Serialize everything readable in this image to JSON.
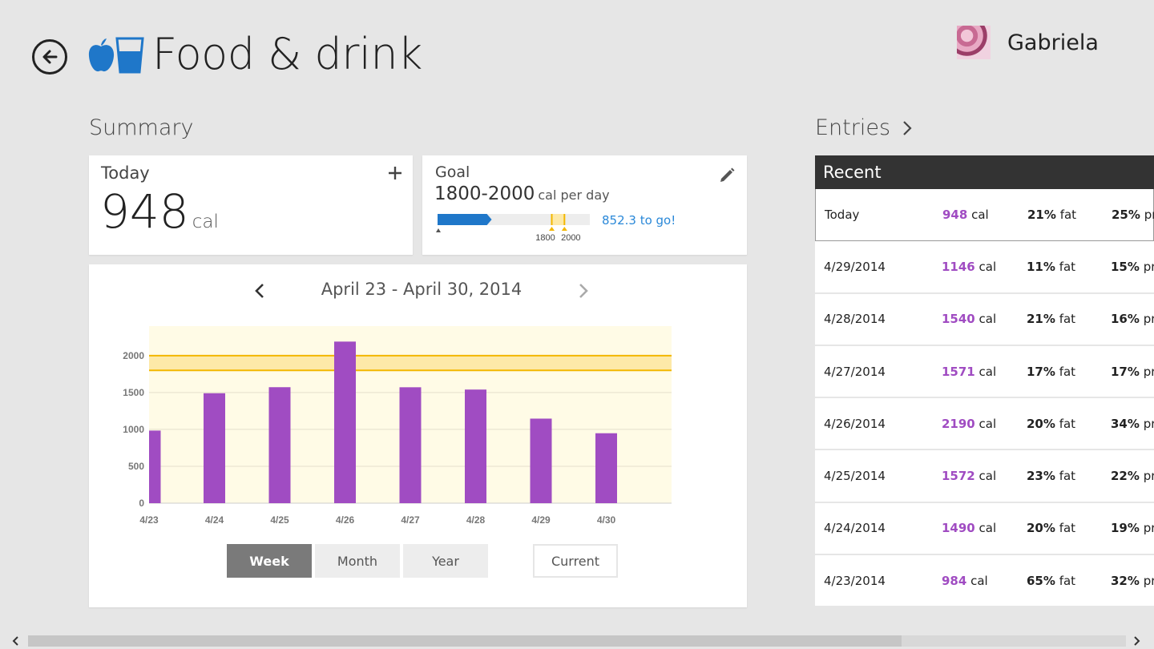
{
  "app": {
    "title": "Food & drink"
  },
  "user": {
    "name": "Gabriela"
  },
  "summary": {
    "title": "Summary",
    "today": {
      "label": "Today",
      "value": "948",
      "unit": "cal"
    },
    "goal": {
      "label": "Goal",
      "range": "1800-2000",
      "unit": "cal per day",
      "to_go": "852.3 to go!",
      "marker_low": "1800",
      "marker_high": "2000",
      "progress_fraction": 0.474,
      "scale_max": 2400
    }
  },
  "colors": {
    "bar": "#a04cc2",
    "goal_band": "#fde9a8",
    "goal_line": "#f3b700",
    "accent": "#1f77c9",
    "chart_bg": "#fffbe6"
  },
  "chart": {
    "date_range": "April 23 - April 30, 2014",
    "buttons": {
      "week": "Week",
      "month": "Month",
      "year": "Year",
      "current": "Current"
    }
  },
  "chart_data": {
    "type": "bar",
    "categories": [
      "4/23",
      "4/24",
      "4/25",
      "4/26",
      "4/27",
      "4/28",
      "4/29",
      "4/30"
    ],
    "values": [
      984,
      1490,
      1572,
      2190,
      1571,
      1540,
      1146,
      948
    ],
    "y_ticks": [
      "0",
      "500",
      "1000",
      "1500",
      "2000"
    ],
    "ylim": [
      0,
      2400
    ],
    "goal_band": [
      1800,
      2000
    ],
    "grid": true
  },
  "entries": {
    "title": "Entries",
    "header": "Recent",
    "rows": [
      {
        "date": "Today",
        "cal": "948",
        "cal_unit": "cal",
        "fat": "21%",
        "fat_unit": "fat",
        "pro": "25%",
        "pro_unit": "pro"
      },
      {
        "date": "4/29/2014",
        "cal": "1146",
        "cal_unit": "cal",
        "fat": "11%",
        "fat_unit": "fat",
        "pro": "15%",
        "pro_unit": "pro"
      },
      {
        "date": "4/28/2014",
        "cal": "1540",
        "cal_unit": "cal",
        "fat": "21%",
        "fat_unit": "fat",
        "pro": "16%",
        "pro_unit": "pro"
      },
      {
        "date": "4/27/2014",
        "cal": "1571",
        "cal_unit": "cal",
        "fat": "17%",
        "fat_unit": "fat",
        "pro": "17%",
        "pro_unit": "pro"
      },
      {
        "date": "4/26/2014",
        "cal": "2190",
        "cal_unit": "cal",
        "fat": "20%",
        "fat_unit": "fat",
        "pro": "34%",
        "pro_unit": "pro"
      },
      {
        "date": "4/25/2014",
        "cal": "1572",
        "cal_unit": "cal",
        "fat": "23%",
        "fat_unit": "fat",
        "pro": "22%",
        "pro_unit": "pro"
      },
      {
        "date": "4/24/2014",
        "cal": "1490",
        "cal_unit": "cal",
        "fat": "20%",
        "fat_unit": "fat",
        "pro": "19%",
        "pro_unit": "pro"
      },
      {
        "date": "4/23/2014",
        "cal": "984",
        "cal_unit": "cal",
        "fat": "65%",
        "fat_unit": "fat",
        "pro": "32%",
        "pro_unit": "pro"
      }
    ]
  }
}
